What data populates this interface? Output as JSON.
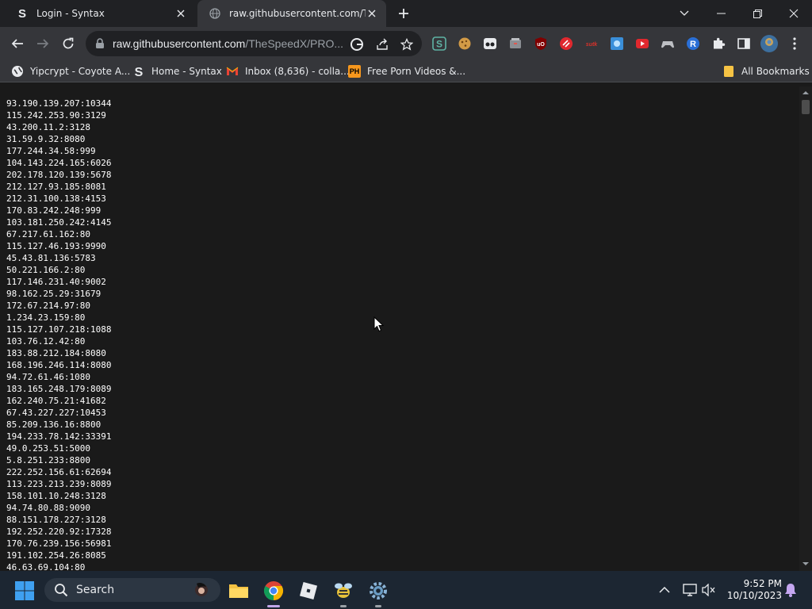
{
  "browser": {
    "tabs": [
      {
        "title": "Login - Syntax",
        "favicon_letter": "S",
        "active": false
      },
      {
        "title": "raw.githubusercontent.com/The",
        "active": true
      }
    ],
    "address": {
      "host": "raw.githubusercontent.com",
      "path": "/TheSpeedX/PRO..."
    },
    "bookmarks": [
      {
        "label": "Yipcrypt - Coyote A...",
        "icon": "globe-icon"
      },
      {
        "label": "Home - Syntax",
        "icon": "syntax-s-icon"
      },
      {
        "label": "Inbox (8,636) - colla...",
        "icon": "gmail-icon"
      },
      {
        "label": "Free Porn Videos &...",
        "icon": "ph-icon",
        "icon_text": "PH"
      }
    ],
    "all_bookmarks_label": "All Bookmarks"
  },
  "content": {
    "lines": [
      "93.190.139.207:10344",
      "115.242.253.90:3129",
      "43.200.11.2:3128",
      "31.59.9.32:8080",
      "177.244.34.58:999",
      "104.143.224.165:6026",
      "202.178.120.139:5678",
      "212.127.93.185:8081",
      "212.31.100.138:4153",
      "170.83.242.248:999",
      "103.181.250.242:4145",
      "67.217.61.162:80",
      "115.127.46.193:9990",
      "45.43.81.136:5783",
      "50.221.166.2:80",
      "117.146.231.40:9002",
      "98.162.25.29:31679",
      "172.67.214.97:80",
      "1.234.23.159:80",
      "115.127.107.218:1088",
      "103.76.12.42:80",
      "183.88.212.184:8080",
      "168.196.246.114:8080",
      "94.72.61.46:1080",
      "183.165.248.179:8089",
      "162.240.75.21:41682",
      "67.43.227.227:10453",
      "85.209.136.16:8800",
      "194.233.78.142:33391",
      "49.0.253.51:5000",
      "5.8.251.233:8800",
      "222.252.156.61:62694",
      "113.223.213.239:8089",
      "158.101.10.248:3128",
      "94.74.80.88:9090",
      "88.151.178.227:3128",
      "192.252.220.92:17328",
      "170.76.239.156:56981",
      "191.102.254.26:8085",
      "46.63.69.104:80"
    ]
  },
  "taskbar": {
    "search_label": "Search",
    "time": "9:52 PM",
    "date": "10/10/2023"
  },
  "colors": {
    "tabstrip": "#202124",
    "toolbar": "#35363a",
    "page_bg": "#1a1a1a",
    "taskbar": "#1c2632",
    "windows_blue": "#3fa0f0"
  }
}
